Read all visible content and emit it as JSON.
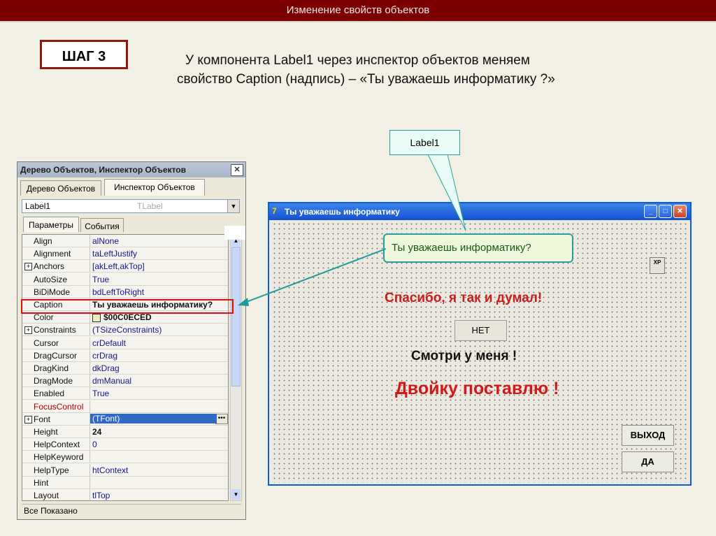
{
  "slide": {
    "header": "Изменение свойств объектов",
    "step": "ШАГ 3",
    "desc_line1": "У компонента Label1 через инспектор объектов меняем",
    "desc_line2": "свойство Caption (надпись) – «Ты уважаешь информатику ?»",
    "callout": "Label1"
  },
  "inspector": {
    "title": "Дерево Объектов, Инспектор Объектов",
    "close_glyph": "✕",
    "tabs": [
      "Дерево Объектов",
      "Инспектор Объектов"
    ],
    "combo": {
      "name": "Label1",
      "type": "TLabel",
      "arrow": "▼"
    },
    "subtabs": [
      "Параметры",
      "События"
    ],
    "rows": [
      {
        "name": "Align",
        "value": "alNone"
      },
      {
        "name": "Alignment",
        "value": "taLeftJustify"
      },
      {
        "name": "Anchors",
        "value": "[akLeft,akTop]",
        "expandable": true
      },
      {
        "name": "AutoSize",
        "value": "True"
      },
      {
        "name": "BiDiMode",
        "value": "bdLeftToRight"
      },
      {
        "name": "Caption",
        "value": "Ты уважаешь информатику?",
        "bold": true
      },
      {
        "name": "Color",
        "value": "$00C0ECED",
        "bold": true,
        "swatch": "#edecc0"
      },
      {
        "name": "Constraints",
        "value": "(TSizeConstraints)",
        "expandable": true
      },
      {
        "name": "Cursor",
        "value": "crDefault"
      },
      {
        "name": "DragCursor",
        "value": "crDrag"
      },
      {
        "name": "DragKind",
        "value": "dkDrag"
      },
      {
        "name": "DragMode",
        "value": "dmManual"
      },
      {
        "name": "Enabled",
        "value": "True"
      },
      {
        "name": "FocusControl",
        "value": "",
        "name_color": "#b00000"
      },
      {
        "name": "Font",
        "value": "(TFont)",
        "expandable": true,
        "selected": true
      },
      {
        "name": "Height",
        "value": "24",
        "bold": true
      },
      {
        "name": "HelpContext",
        "value": "0"
      },
      {
        "name": "HelpKeyword",
        "value": ""
      },
      {
        "name": "HelpType",
        "value": "htContext"
      },
      {
        "name": "Hint",
        "value": ""
      },
      {
        "name": "Layout",
        "value": "tlTop"
      }
    ],
    "status": "Все Показано"
  },
  "form": {
    "title": "Ты уважаешь информатику",
    "icon_glyph": "7",
    "minimize_glyph": "_",
    "maximize_glyph": "□",
    "close_glyph": "✕",
    "label1_text": "Ты уважаешь информатику?",
    "xp_icon_text": "XP",
    "thanks_text": "Спасибо, я так и думал!",
    "no_button": "НЕТ",
    "look_text": "Смотри у меня !",
    "grade_text": "Двойку поставлю !",
    "exit_button": "ВЫХОД",
    "yes_button": "ДА"
  },
  "colors": {
    "header_bg": "#7d0000",
    "highlight_red": "#e31010",
    "callout_teal": "#2e9e9e",
    "form_titlebar": "#1451d2"
  }
}
